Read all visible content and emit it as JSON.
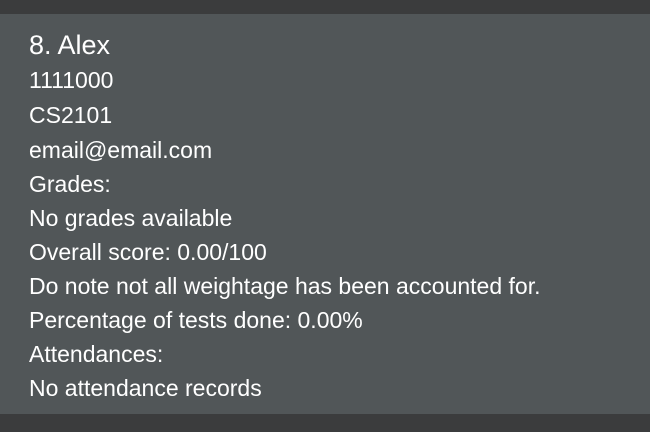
{
  "person": {
    "index_name": "8. Alex",
    "matric": "1111000",
    "module": "CS2101",
    "email": "email@email.com",
    "grades_label": "Grades:",
    "grades_value": "No grades available",
    "overall_score": "Overall score: 0.00/100",
    "weightage_note": "Do note not all weightage has been accounted for.",
    "tests_done": "Percentage of tests done: 0.00%",
    "attendances_label": "Attendances:",
    "attendances_value": "No attendance records"
  },
  "colors": {
    "background": "#3b3c3d",
    "card": "#515658",
    "text": "#ffffff"
  }
}
